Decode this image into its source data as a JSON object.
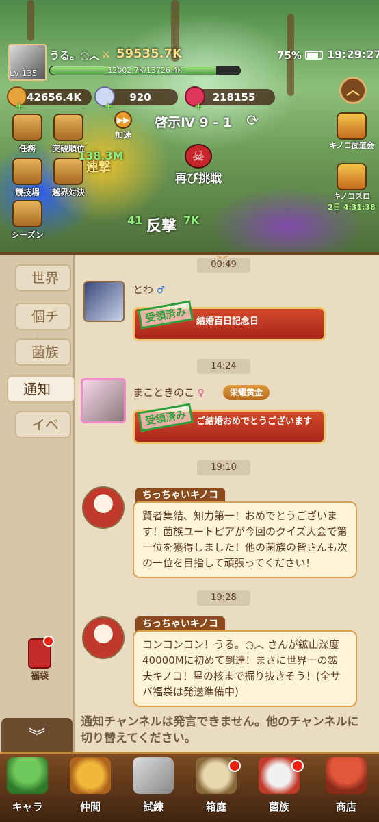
{
  "hud": {
    "player_name": "うる。○︿",
    "level": "Lv 135",
    "power": "59535.7K",
    "hp_text": "12002.7K/13726.4K",
    "hp_fraction": 0.874,
    "battery": "75%",
    "clock": "19:29:27"
  },
  "currencies": {
    "gold": "42656.4K",
    "diamond": "920",
    "ruby": "218155"
  },
  "stage": {
    "name": "啓示Ⅳ 9 - 1",
    "speed_label": "加速",
    "retry_label": "再び挑戦"
  },
  "left_menu": [
    {
      "label": "任務"
    },
    {
      "label": "突破順位"
    },
    {
      "label": "競技場"
    },
    {
      "label": "越界対決"
    },
    {
      "label": "シーズン"
    }
  ],
  "right_menu": {
    "martial": "キノコ武道会",
    "cosmo": "キノコスロ",
    "cosmo_timer": "2日 4:31:38"
  },
  "battle_text": {
    "dmg1": "138.3M",
    "dmg2": "41",
    "dmg3": "7K",
    "word1": "連撃",
    "word2": "反撃"
  },
  "chat_tabs": [
    {
      "label": "世界"
    },
    {
      "label": "個チャ"
    },
    {
      "label": "菌族"
    },
    {
      "label": "通知"
    },
    {
      "label": "イベ"
    }
  ],
  "fukubukuro_label": "福袋",
  "messages": {
    "ts0": "00:49",
    "m1": {
      "name": "とわ",
      "gender": "♂",
      "stamp": "受領済み",
      "card_text": "結婚百日記念日"
    },
    "ts1": "14:24",
    "m2": {
      "name": "まこときのこ",
      "gender": "♀",
      "badge": "栄耀黄金",
      "stamp": "受領済み",
      "card_text": "ご結婚おめでとうございます"
    },
    "ts2": "19:10",
    "m3": {
      "name": "ちっちゃいキノコ",
      "text": "賢者集結、知力第一！おめでとうございます！菌族ユートピアが今回のクイズ大会で第一位を獲得しました！他の菌族の皆さんも次の一位を目指して頑張ってください！"
    },
    "ts3": "19:28",
    "m4": {
      "name": "ちっちゃいキノコ",
      "text": "コンコンコン！うる。○︿ さんが鉱山深度40000Mに初めて到達！まさに世界一の鉱夫キノコ！星の核まで掘り抜きそう！(全サバ福袋は発送準備中)"
    }
  },
  "notice": "通知チャンネルは発言できません。他のチャンネルに切り替えてください。",
  "nav": [
    {
      "label": "キャラ"
    },
    {
      "label": "仲間"
    },
    {
      "label": "試練"
    },
    {
      "label": "箱庭"
    },
    {
      "label": "菌族"
    },
    {
      "label": "商店"
    }
  ]
}
